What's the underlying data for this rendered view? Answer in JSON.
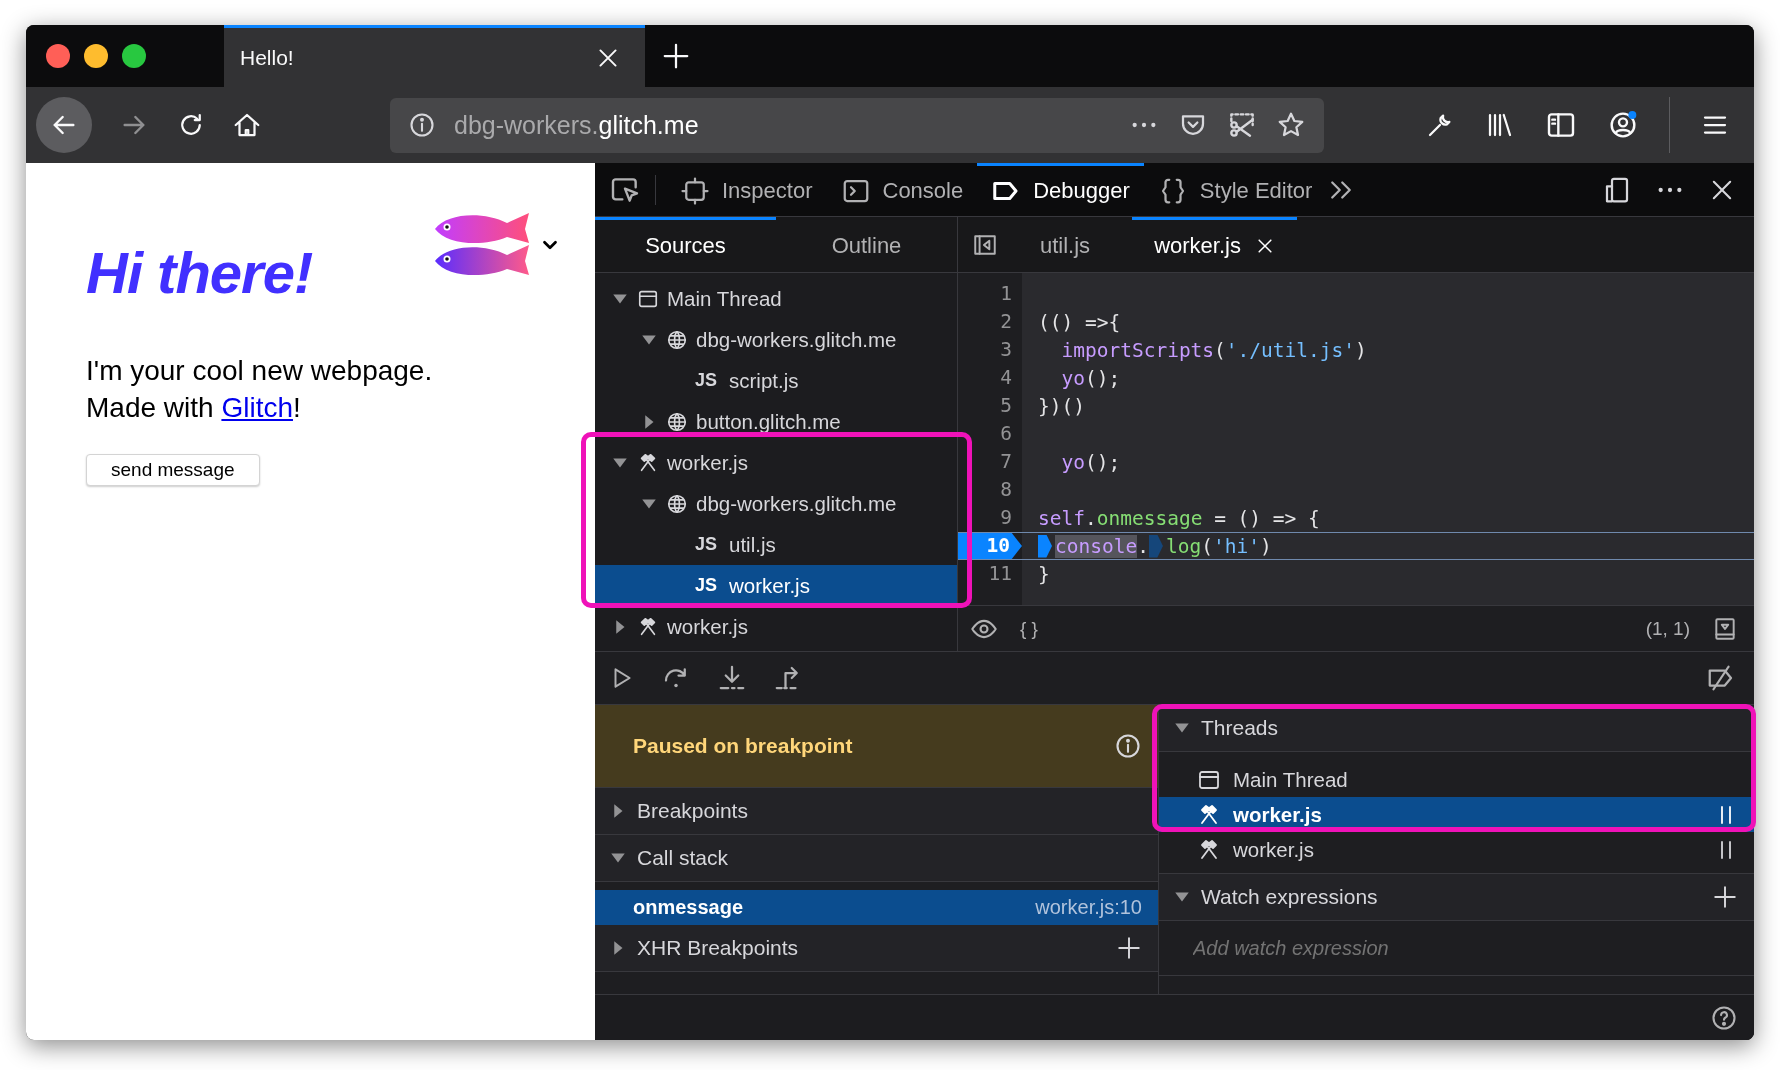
{
  "browser": {
    "tabs": [
      {
        "title": "Hello!",
        "selected": true
      }
    ],
    "url": {
      "subdomain": "dbg-workers.",
      "domain": "glitch.me"
    }
  },
  "webpage": {
    "heading": "Hi there!",
    "line_1": "I'm your cool new webpage.",
    "line_2_before": "Made with ",
    "link": "Glitch",
    "line_2_after": "!",
    "button": "send message"
  },
  "devtools": {
    "tabs": [
      {
        "label": "Inspector",
        "selected": false
      },
      {
        "label": "Console",
        "selected": false
      },
      {
        "label": "Debugger",
        "selected": true
      },
      {
        "label": "Style Editor",
        "selected": false
      }
    ],
    "sidebar_tabs": [
      {
        "label": "Sources",
        "selected": true
      },
      {
        "label": "Outline",
        "selected": false
      }
    ],
    "source_tree": [
      {
        "kind": "thread",
        "label": "Main Thread",
        "expanded": true,
        "selected": false,
        "children": [
          {
            "kind": "domain",
            "label": "dbg-workers.glitch.me",
            "expanded": true,
            "selected": false,
            "children": [
              {
                "kind": "file",
                "badge": "JS",
                "label": "script.js",
                "selected": false
              }
            ]
          },
          {
            "kind": "domain",
            "label": "button.glitch.me",
            "expanded": false,
            "selected": false
          }
        ]
      },
      {
        "kind": "worker",
        "label": "worker.js",
        "expanded": true,
        "selected": false,
        "children": [
          {
            "kind": "domain",
            "label": "dbg-workers.glitch.me",
            "expanded": true,
            "selected": false,
            "children": [
              {
                "kind": "file",
                "badge": "JS",
                "label": "util.js",
                "selected": false
              },
              {
                "kind": "file",
                "badge": "JS",
                "label": "worker.js",
                "selected": true
              }
            ]
          }
        ]
      },
      {
        "kind": "worker",
        "label": "worker.js",
        "expanded": false,
        "selected": false
      }
    ],
    "editor_tabs": [
      {
        "label": "util.js",
        "selected": false
      },
      {
        "label": "worker.js",
        "selected": true
      }
    ],
    "code": [
      {
        "number": "1",
        "paused": false
      },
      {
        "number": "2",
        "paused": false,
        "tokens": [
          {
            "kind": "plain",
            "text": "(() =>{"
          }
        ]
      },
      {
        "number": "3",
        "paused": false,
        "tokens": [
          {
            "kind": "name",
            "text": "  importScripts"
          },
          {
            "kind": "plain",
            "text": "("
          },
          {
            "kind": "string",
            "text": "'./util.js'"
          },
          {
            "kind": "plain",
            "text": ")"
          }
        ]
      },
      {
        "number": "4",
        "paused": false,
        "tokens": [
          {
            "kind": "name",
            "text": "  yo"
          },
          {
            "kind": "plain",
            "text": "();"
          }
        ]
      },
      {
        "number": "5",
        "paused": false,
        "tokens": [
          {
            "kind": "plain",
            "text": "})()"
          }
        ]
      },
      {
        "number": "6",
        "paused": false
      },
      {
        "number": "7",
        "paused": false,
        "tokens": [
          {
            "kind": "name",
            "text": "  yo"
          },
          {
            "kind": "plain",
            "text": "();"
          }
        ]
      },
      {
        "number": "8",
        "paused": false
      },
      {
        "number": "9",
        "paused": false,
        "tokens": [
          {
            "kind": "name",
            "text": "self"
          },
          {
            "kind": "plain",
            "text": "."
          },
          {
            "kind": "prop",
            "text": "onmessage"
          },
          {
            "kind": "plain",
            "text": " = () => {"
          }
        ]
      },
      {
        "number": "10",
        "paused": true,
        "tokens": [
          {
            "kind": "marker",
            "active": true
          },
          {
            "kind": "match",
            "text": "console"
          },
          {
            "kind": "plain",
            "text": "."
          },
          {
            "kind": "marker",
            "active": false
          },
          {
            "kind": "prop",
            "text": "log"
          },
          {
            "kind": "plain",
            "text": "("
          },
          {
            "kind": "string",
            "text": "'hi'"
          },
          {
            "kind": "plain",
            "text": ")"
          }
        ]
      },
      {
        "number": "11",
        "paused": false,
        "tokens": [
          {
            "kind": "plain",
            "text": "}"
          }
        ]
      }
    ],
    "editor_footer": {
      "pretty_print": "{ }",
      "cursor": "(1, 1)"
    },
    "pause_message": "Paused on breakpoint",
    "left_panes": [
      {
        "kind": "breakpoints",
        "title": "Breakpoints",
        "expanded": false
      },
      {
        "kind": "call_stack",
        "title": "Call stack",
        "expanded": true,
        "frames": [
          {
            "name": "onmessage",
            "location": "worker.js:10",
            "selected": true
          }
        ]
      },
      {
        "kind": "xhr",
        "title": "XHR Breakpoints",
        "expanded": false
      }
    ],
    "right_panes": [
      {
        "kind": "threads",
        "title": "Threads",
        "expanded": true,
        "threads": [
          {
            "kind": "main",
            "label": "Main Thread",
            "selected": false
          },
          {
            "kind": "worker",
            "label": "worker.js",
            "selected": true
          },
          {
            "kind": "worker",
            "label": "worker.js",
            "selected": false
          }
        ]
      },
      {
        "kind": "watch",
        "title": "Watch expressions",
        "expanded": true,
        "placeholder": "Add watch expression"
      }
    ]
  }
}
